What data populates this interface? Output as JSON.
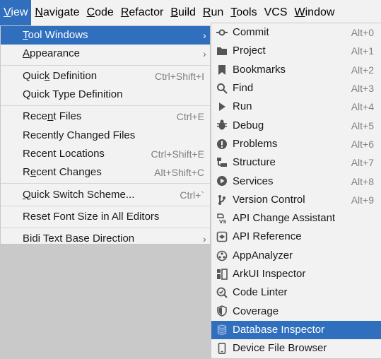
{
  "menubar": {
    "items": [
      {
        "label": "View",
        "mnemonic": "V",
        "rest": "iew"
      },
      {
        "label": "Navigate",
        "mnemonic": "N",
        "rest": "avigate"
      },
      {
        "label": "Code",
        "mnemonic": "C",
        "rest": "ode"
      },
      {
        "label": "Refactor",
        "mnemonic": "R",
        "rest": "efactor"
      },
      {
        "label": "Build",
        "mnemonic": "B",
        "rest": "uild"
      },
      {
        "label": "Run",
        "mnemonic": "R",
        "rest": "un",
        "pre": ""
      },
      {
        "label": "Tools",
        "mnemonic": "T",
        "rest": "ools"
      },
      {
        "label": "VCS",
        "mnemonic": "",
        "rest": "VCS"
      },
      {
        "label": "Window",
        "mnemonic": "W",
        "rest": "indow"
      }
    ]
  },
  "view_menu": {
    "items": [
      {
        "pre": "",
        "mn": "T",
        "post": "ool Windows",
        "shortcut": "",
        "submenu": true
      },
      {
        "pre": "",
        "mn": "A",
        "post": "ppearance",
        "shortcut": "",
        "submenu": true
      },
      {
        "pre": "Quic",
        "mn": "k",
        "post": " Definition",
        "shortcut": "Ctrl+Shift+I"
      },
      {
        "pre": "Quick Type Definition",
        "mn": "",
        "post": "",
        "shortcut": ""
      },
      {
        "pre": "Rece",
        "mn": "n",
        "post": "t Files",
        "shortcut": "Ctrl+E"
      },
      {
        "pre": "Recently Changed Files",
        "mn": "",
        "post": "",
        "shortcut": ""
      },
      {
        "pre": "Recent Locations",
        "mn": "",
        "post": "",
        "shortcut": "Ctrl+Shift+E"
      },
      {
        "pre": "R",
        "mn": "e",
        "post": "cent Changes",
        "shortcut": "Alt+Shift+C"
      },
      {
        "pre": "",
        "mn": "Q",
        "post": "uick Switch Scheme...",
        "shortcut": "Ctrl+`"
      },
      {
        "pre": "Reset Font Size in All Editors",
        "mn": "",
        "post": "",
        "shortcut": ""
      },
      {
        "pre": "Bidi Text Base Direction",
        "mn": "",
        "post": "",
        "shortcut": "",
        "submenu": true
      }
    ]
  },
  "tool_windows": {
    "items": [
      {
        "label": "Commit",
        "shortcut": "Alt+0",
        "icon": "commit-icon"
      },
      {
        "label": "Project",
        "shortcut": "Alt+1",
        "icon": "folder-icon"
      },
      {
        "label": "Bookmarks",
        "shortcut": "Alt+2",
        "icon": "bookmark-icon"
      },
      {
        "label": "Find",
        "shortcut": "Alt+3",
        "icon": "search-icon"
      },
      {
        "label": "Run",
        "shortcut": "Alt+4",
        "icon": "play-icon"
      },
      {
        "label": "Debug",
        "shortcut": "Alt+5",
        "icon": "bug-icon"
      },
      {
        "label": "Problems",
        "shortcut": "Alt+6",
        "icon": "warning-icon"
      },
      {
        "label": "Structure",
        "shortcut": "Alt+7",
        "icon": "structure-icon"
      },
      {
        "label": "Services",
        "shortcut": "Alt+8",
        "icon": "services-icon"
      },
      {
        "label": "Version Control",
        "shortcut": "Alt+9",
        "icon": "branch-icon"
      },
      {
        "label": "API Change Assistant",
        "shortcut": "",
        "icon": "api-change-icon"
      },
      {
        "label": "API Reference",
        "shortcut": "",
        "icon": "api-reference-icon"
      },
      {
        "label": "AppAnalyzer",
        "shortcut": "",
        "icon": "app-analyzer-icon"
      },
      {
        "label": "ArkUI Inspector",
        "shortcut": "",
        "icon": "inspector-icon"
      },
      {
        "label": "Code Linter",
        "shortcut": "",
        "icon": "linter-icon"
      },
      {
        "label": "Coverage",
        "shortcut": "",
        "icon": "shield-icon"
      },
      {
        "label": "Database Inspector",
        "shortcut": "",
        "icon": "database-icon"
      },
      {
        "label": "Device File Browser",
        "shortcut": "",
        "icon": "device-icon"
      }
    ]
  },
  "colors": {
    "selection": "#2f6fbd",
    "menu_bg": "#f2f2f2",
    "shortcut": "#808080"
  }
}
